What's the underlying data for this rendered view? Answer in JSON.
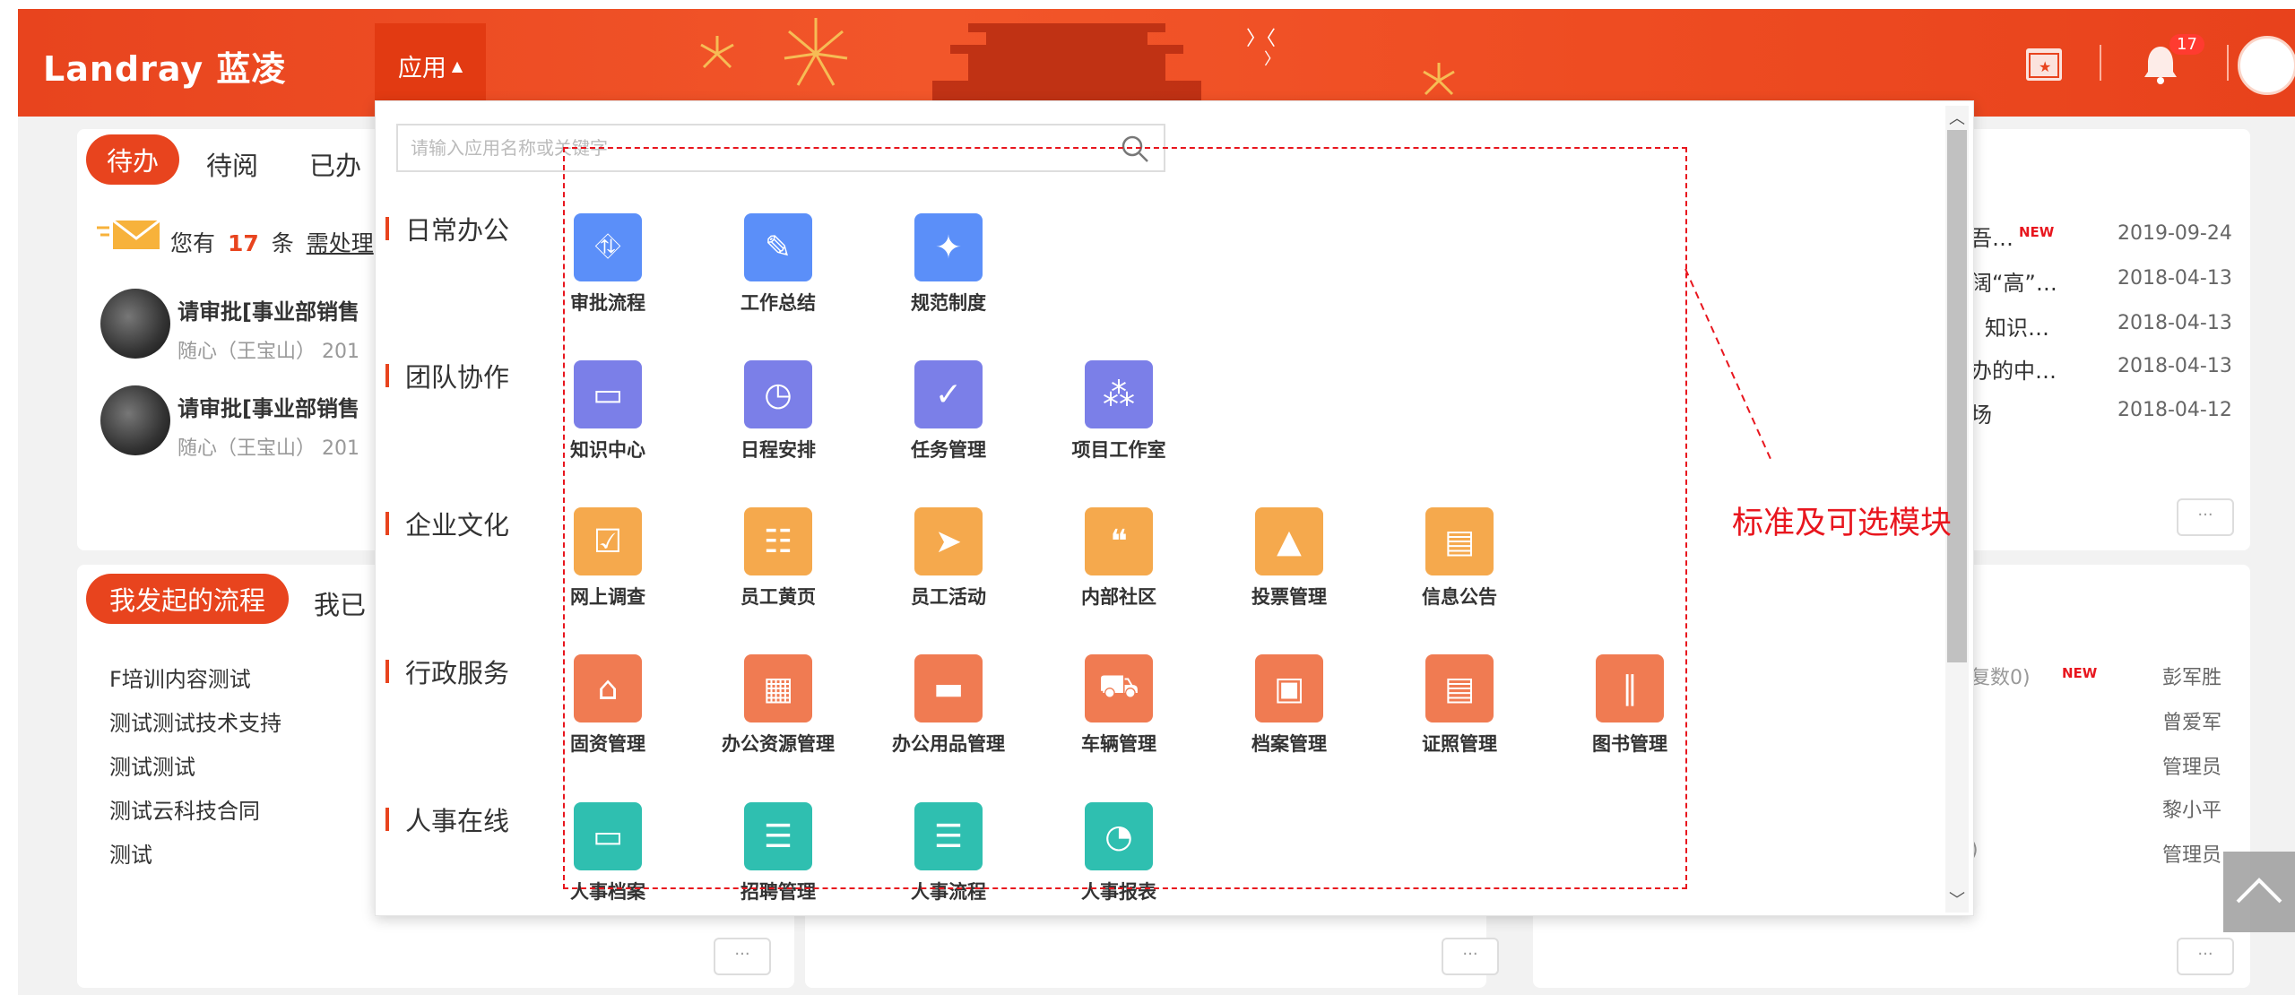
{
  "header": {
    "logo": "Landray 蓝凌",
    "app_menu_label": "应用",
    "notification_count": "17"
  },
  "todo_card": {
    "tabs": [
      "待办",
      "待阅",
      "已办"
    ],
    "summary_prefix": "您有",
    "summary_count": "17",
    "summary_mid": "条",
    "summary_link": "需处理",
    "items": [
      {
        "title": "请审批[事业部销售",
        "meta": "随心（王宝山）  201"
      },
      {
        "title": "请审批[事业部销售",
        "meta": "随心（王宝山）  201"
      }
    ]
  },
  "flow_card": {
    "tabs": [
      "我发起的流程",
      "我已"
    ],
    "items": [
      "F培训内容测试",
      "测试测试技术支持",
      "测试测试",
      "测试云科技合同",
      "测试"
    ]
  },
  "news_card": {
    "items": [
      {
        "title": "吾…",
        "new": "NEW",
        "date": "2019-09-24"
      },
      {
        "title": "阔“高”…",
        "date": "2018-04-13"
      },
      {
        "title": "知识…",
        "date": "2018-04-13"
      },
      {
        "title": "办的中…",
        "date": "2018-04-13"
      },
      {
        "title": "场",
        "date": "2018-04-12"
      }
    ]
  },
  "people_card": {
    "items": [
      {
        "title": "复数0)",
        "new": "NEW",
        "person": "彭军胜"
      },
      {
        "title": "",
        "person": "曾爱军"
      },
      {
        "title": "",
        "person": "管理员"
      },
      {
        "title": "",
        "person": "黎小平"
      },
      {
        "title": ")",
        "person": "管理员"
      }
    ]
  },
  "panel": {
    "search_placeholder": "请输入应用名称或关键字",
    "categories": [
      {
        "name": "日常办公",
        "apps": [
          {
            "label": "审批流程",
            "icon": "org-chart-icon",
            "color": "#5b8ff9"
          },
          {
            "label": "工作总结",
            "icon": "edit-doc-icon",
            "color": "#5b8ff9"
          },
          {
            "label": "规范制度",
            "icon": "satellite-icon",
            "color": "#5b8ff9"
          }
        ]
      },
      {
        "name": "团队协作",
        "apps": [
          {
            "label": "知识中心",
            "icon": "inbox-icon",
            "color": "#7b7fe8"
          },
          {
            "label": "日程安排",
            "icon": "clock-icon",
            "color": "#7b7fe8"
          },
          {
            "label": "任务管理",
            "icon": "clipboard-check-icon",
            "color": "#7b7fe8"
          },
          {
            "label": "项目工作室",
            "icon": "team-icon",
            "color": "#7b7fe8"
          }
        ]
      },
      {
        "name": "企业文化",
        "apps": [
          {
            "label": "网上调查",
            "icon": "checkbox-icon",
            "color": "#f5a94d"
          },
          {
            "label": "员工黄页",
            "icon": "contacts-icon",
            "color": "#f5a94d"
          },
          {
            "label": "员工活动",
            "icon": "paper-plane-icon",
            "color": "#f5a94d"
          },
          {
            "label": "内部社区",
            "icon": "chat-icon",
            "color": "#f5a94d"
          },
          {
            "label": "投票管理",
            "icon": "vote-icon",
            "color": "#f5a94d"
          },
          {
            "label": "信息公告",
            "icon": "notice-icon",
            "color": "#f5a94d"
          }
        ]
      },
      {
        "name": "行政服务",
        "apps": [
          {
            "label": "固资管理",
            "icon": "asset-icon",
            "color": "#f07b52"
          },
          {
            "label": "办公资源管理",
            "icon": "printer-icon",
            "color": "#f07b52"
          },
          {
            "label": "办公用品管理",
            "icon": "briefcase-icon",
            "color": "#f07b52"
          },
          {
            "label": "车辆管理",
            "icon": "car-icon",
            "color": "#f07b52"
          },
          {
            "label": "档案管理",
            "icon": "archive-icon",
            "color": "#f07b52"
          },
          {
            "label": "证照管理",
            "icon": "id-card-icon",
            "color": "#f07b52"
          },
          {
            "label": "图书管理",
            "icon": "books-icon",
            "color": "#f07b52"
          }
        ]
      },
      {
        "name": "人事在线",
        "apps": [
          {
            "label": "人事档案",
            "icon": "folder-icon",
            "color": "#2fbfb0"
          },
          {
            "label": "招聘管理",
            "icon": "resume-icon",
            "color": "#2fbfb0"
          },
          {
            "label": "人事流程",
            "icon": "document-icon",
            "color": "#2fbfb0"
          },
          {
            "label": "人事报表",
            "icon": "pie-chart-icon",
            "color": "#2fbfb0"
          }
        ]
      }
    ]
  },
  "annotation": "标准及可选模块",
  "more_label": "···"
}
